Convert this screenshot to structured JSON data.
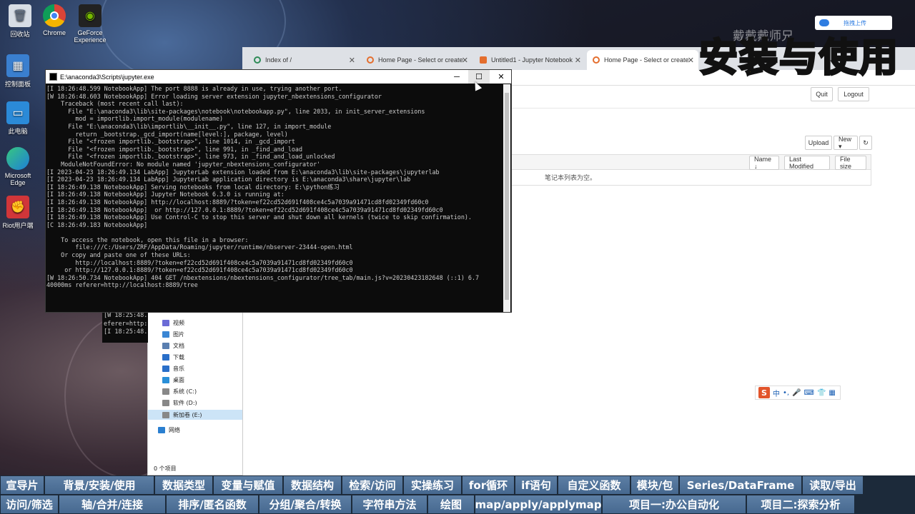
{
  "desktop": {
    "icons": [
      {
        "label": "回收站",
        "icon": "recycle-bin-icon"
      },
      {
        "label": "Chrome",
        "icon": "chrome-icon"
      },
      {
        "label": "GeForce Experience",
        "icon": "geforce-icon"
      },
      {
        "label": "控制面板",
        "icon": "control-panel-icon"
      },
      {
        "label": "此电脑",
        "icon": "this-pc-icon"
      },
      {
        "label": "Microsoft Edge",
        "icon": "edge-icon"
      },
      {
        "label": "Riot用户端",
        "icon": "riot-icon"
      }
    ]
  },
  "browser": {
    "tabs": [
      {
        "label": "Index of /"
      },
      {
        "label": "Home Page - Select or create"
      },
      {
        "label": "Untitled1 - Jupyter Notebook"
      },
      {
        "label": "Home Page - Select or create"
      }
    ],
    "header": {
      "quit_label": "Quit",
      "logout_label": "Logout"
    },
    "toolbar": {
      "upload_label": "Upload",
      "new_label": "New ▾",
      "refresh_icon": "refresh-icon"
    },
    "list": {
      "sort_name_label": "Name ↓",
      "last_modified_label": "Last Modified",
      "file_size_label": "File size",
      "empty_message": "笔记本列表为空。"
    }
  },
  "overlay": {
    "title": "安装与使用",
    "watermark": "戴戴戴师兄",
    "cloud_badge": "拖拽上传"
  },
  "ime": {
    "logo": "S",
    "mode": "中"
  },
  "explorer": {
    "items": [
      {
        "label": "视频",
        "color": "#6b6bd6"
      },
      {
        "label": "图片",
        "color": "#3a86d4"
      },
      {
        "label": "文档",
        "color": "#5a7fb0"
      },
      {
        "label": "下载",
        "color": "#2a6fc9"
      },
      {
        "label": "音乐",
        "color": "#2a6fc9"
      },
      {
        "label": "桌面",
        "color": "#2a8fd8"
      },
      {
        "label": "系统 (C:)",
        "color": "#888888"
      },
      {
        "label": "软件 (D:)",
        "color": "#888888"
      },
      {
        "label": "新加卷 (E:)",
        "color": "#888888"
      },
      {
        "label": "网络",
        "color": "#2a7fd0"
      }
    ],
    "status": "0 个项目"
  },
  "term2": {
    "lines": [
      "[W 18:25:48.",
      "eferer=http:",
      "[I 18:25:48."
    ]
  },
  "terminal": {
    "title": "E:\\anaconda3\\Scripts\\jupyter.exe",
    "lines": [
      "[I 18:26:48.599 NotebookApp] The port 8888 is already in use, trying another port.",
      "[W 18:26:48.603 NotebookApp] Error loading server extension jupyter_nbextensions_configurator",
      "    Traceback (most recent call last):",
      "      File \"E:\\anaconda3\\lib\\site-packages\\notebook\\notebookapp.py\", line 2033, in init_server_extensions",
      "        mod = importlib.import_module(modulename)",
      "      File \"E:\\anaconda3\\lib\\importlib\\__init__.py\", line 127, in import_module",
      "        return _bootstrap._gcd_import(name[level:], package, level)",
      "      File \"<frozen importlib._bootstrap>\", line 1014, in _gcd_import",
      "      File \"<frozen importlib._bootstrap>\", line 991, in _find_and_load",
      "      File \"<frozen importlib._bootstrap>\", line 973, in _find_and_load_unlocked",
      "    ModuleNotFoundError: No module named 'jupyter_nbextensions_configurator'",
      "[I 2023-04-23 18:26:49.134 LabApp] JupyterLab extension loaded from E:\\anaconda3\\lib\\site-packages\\jupyterlab",
      "[I 2023-04-23 18:26:49.134 LabApp] JupyterLab application directory is E:\\anaconda3\\share\\jupyter\\lab",
      "[I 18:26:49.138 NotebookApp] Serving notebooks from local directory: E:\\python练习",
      "[I 18:26:49.138 NotebookApp] Jupyter Notebook 6.3.0 is running at:",
      "[I 18:26:49.138 NotebookApp] http://localhost:8889/?token=ef22cd52d691f408ce4c5a7039a91471cd8fd02349fd60c0",
      "[I 18:26:49.138 NotebookApp]  or http://127.0.0.1:8889/?token=ef22cd52d691f408ce4c5a7039a91471cd8fd02349fd60c0",
      "[I 18:26:49.138 NotebookApp] Use Control-C to stop this server and shut down all kernels (twice to skip confirmation).",
      "[C 18:26:49.183 NotebookApp]",
      "",
      "    To access the notebook, open this file in a browser:",
      "        file:///C:/Users/ZRF/AppData/Roaming/jupyter/runtime/nbserver-23444-open.html",
      "    Or copy and paste one of these URLs:",
      "        http://localhost:8889/?token=ef22cd52d691f408ce4c5a7039a91471cd8fd02349fd60c0",
      "     or http://127.0.0.1:8889/?token=ef22cd52d691f408ce4c5a7039a91471cd8fd02349fd60c0",
      "[W 18:26:50.734 NotebookApp] 404 GET /nbextensions/nbextensions_configurator/tree_tab/main.js?v=20230423182648 (::1) 6.7",
      "40000ms referer=http://localhost:8889/tree"
    ]
  },
  "nav": {
    "row1": [
      "宣导片",
      "背景/安装/使用",
      "数据类型",
      "变量与赋值",
      "数据结构",
      "检索/访问",
      "实操练习",
      "for循环",
      "if语句",
      "自定义函数",
      "模块/包",
      "Series/DataFrame",
      "读取/导出"
    ],
    "row2": [
      "访问/筛选",
      "轴/合并/连接",
      "排序/匿名函数",
      "分组/聚合/转换",
      "字符串方法",
      "绘图",
      "map/apply/applymap",
      "项目一:办公自动化",
      "项目二:探索分析"
    ]
  }
}
